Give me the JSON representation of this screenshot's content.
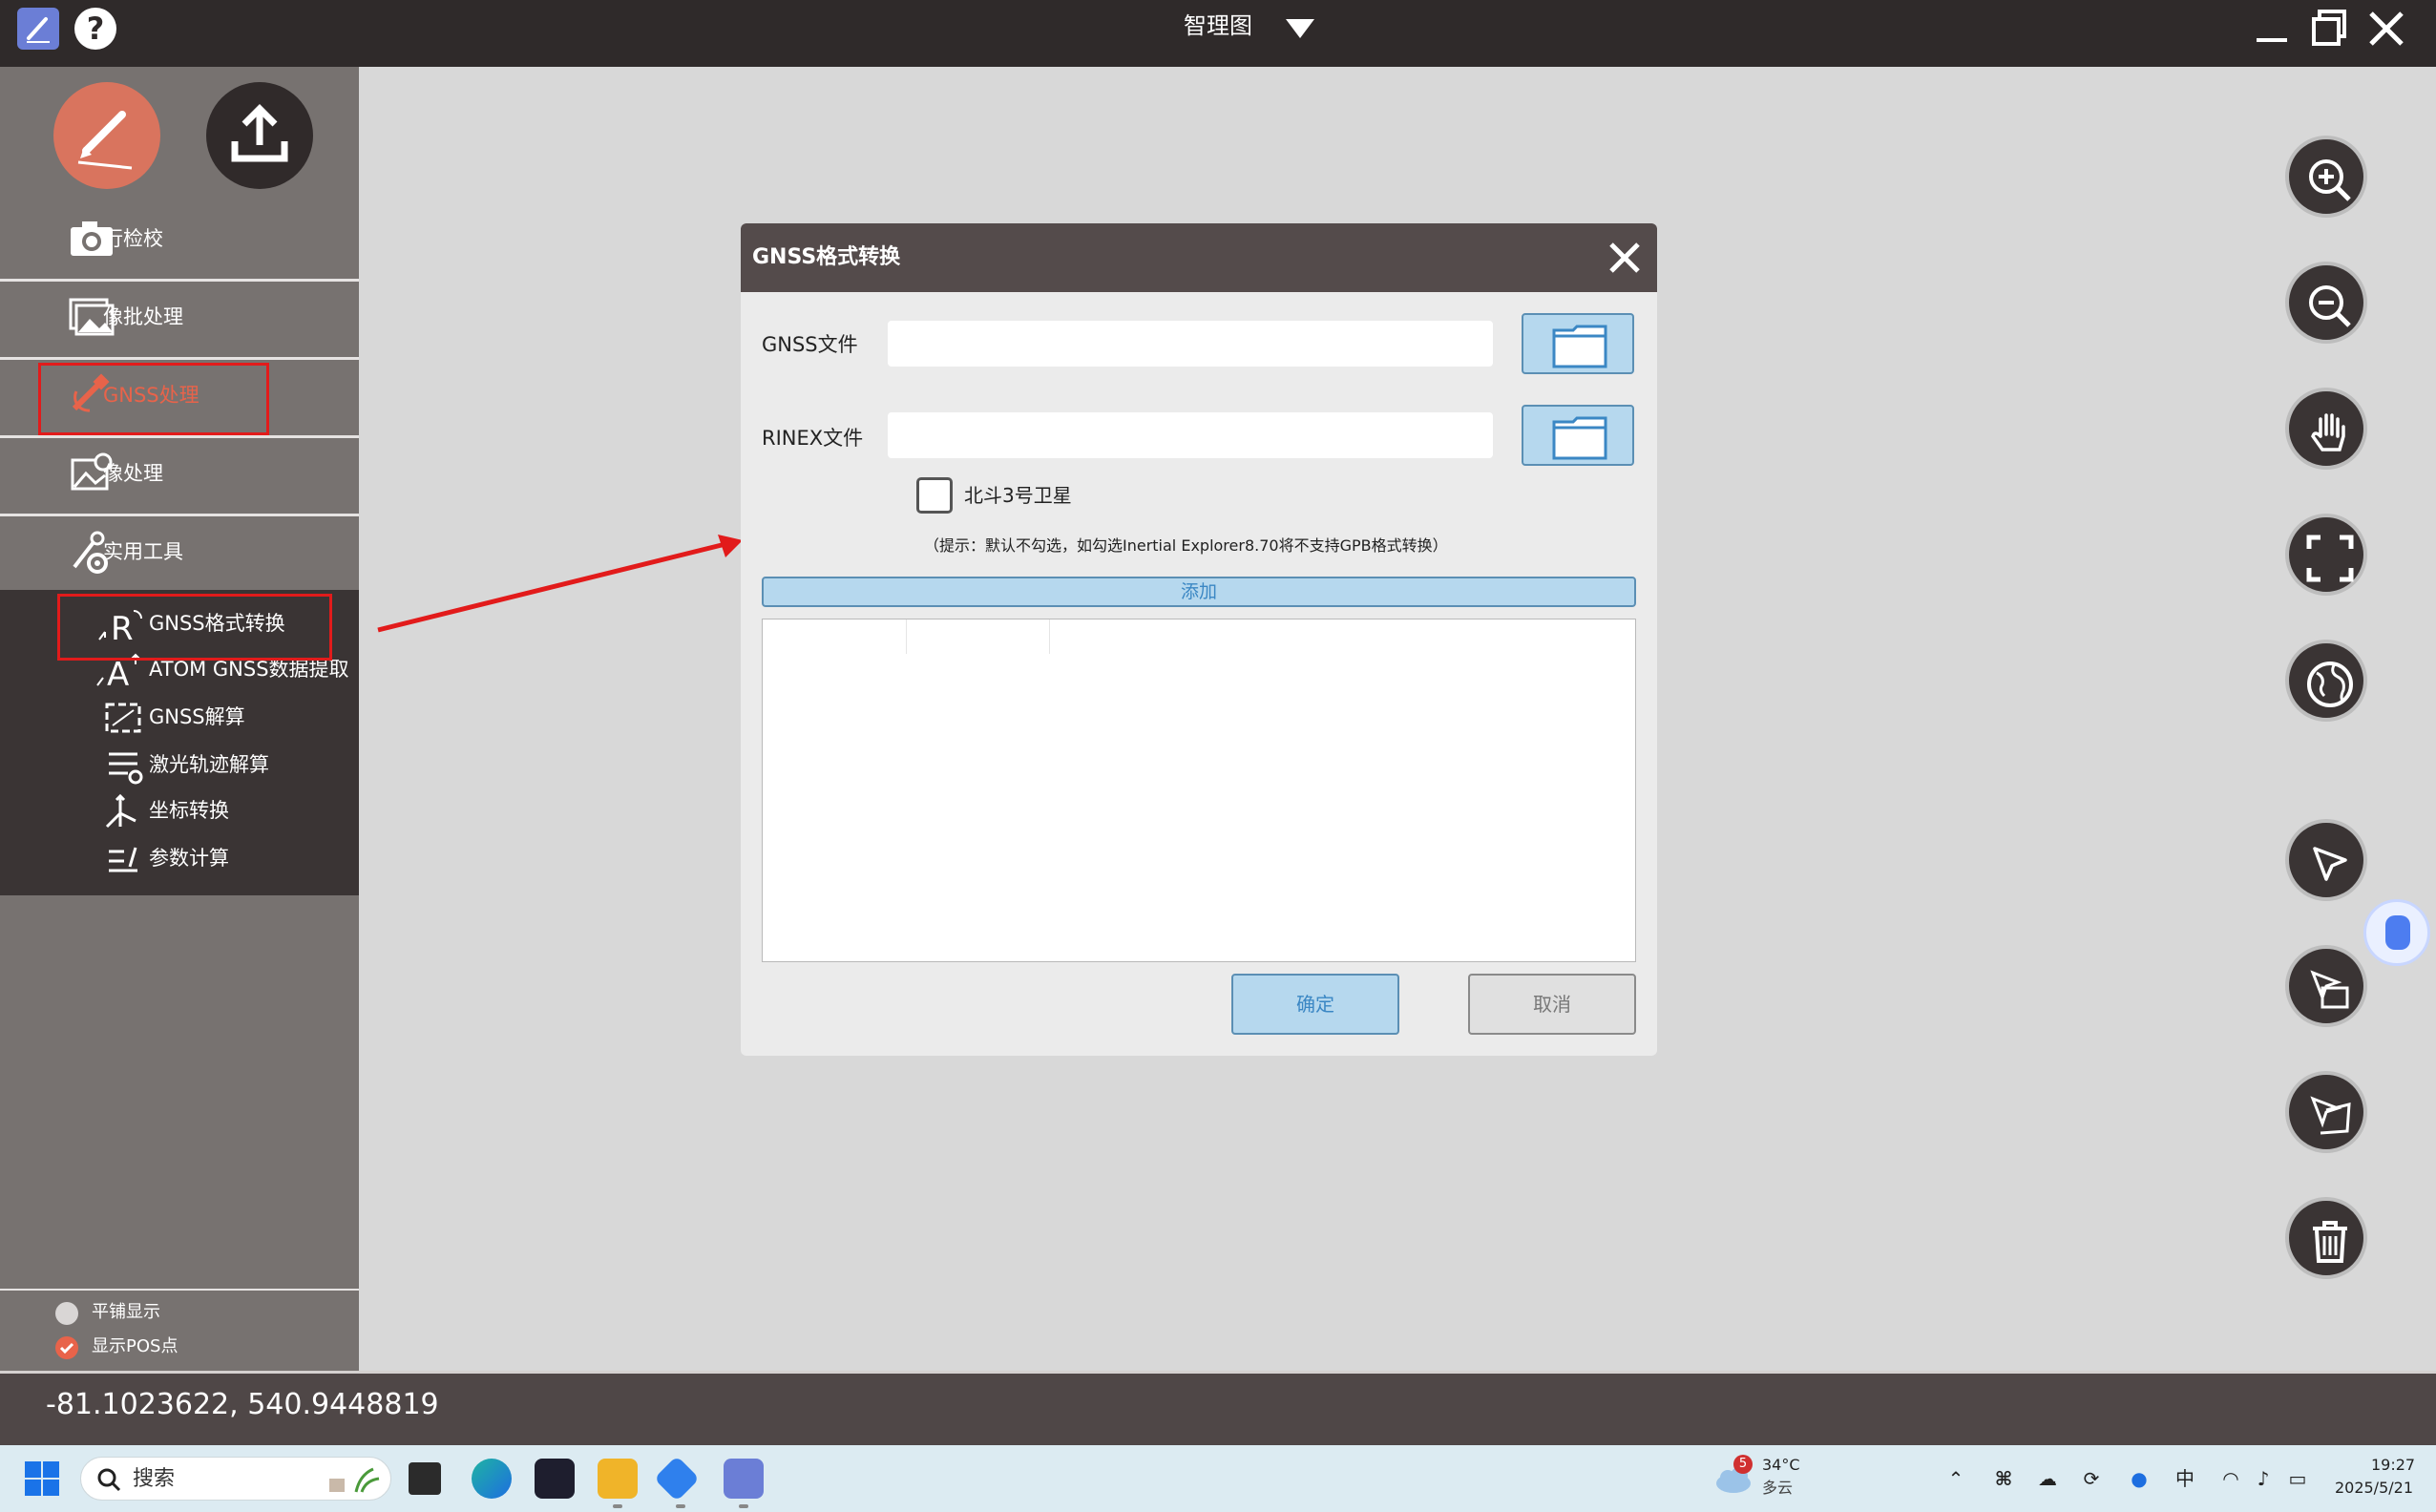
{
  "window": {
    "title": "智理图"
  },
  "sidebar": {
    "items": [
      {
        "label": "行检校",
        "icon": "camera-icon"
      },
      {
        "label": "像批处理",
        "icon": "image-batch-icon"
      },
      {
        "label": "GNSS处理",
        "icon": "satellite-icon",
        "selected": true
      },
      {
        "label": "像处理",
        "icon": "image-process-icon"
      },
      {
        "label": "实用工具",
        "icon": "tools-icon"
      }
    ],
    "subitems": [
      {
        "label": "GNSS格式转换",
        "icon": "rinex-convert-icon"
      },
      {
        "label": "ATOM GNSS数据提取",
        "icon": "atom-extract-icon"
      },
      {
        "label": "GNSS解算",
        "icon": "gnss-solve-icon"
      },
      {
        "label": "激光轨迹解算",
        "icon": "laser-trajectory-icon"
      },
      {
        "label": "坐标转换",
        "icon": "coordinate-icon"
      },
      {
        "label": "参数计算",
        "icon": "parameter-icon"
      }
    ],
    "options": [
      {
        "label": "平铺显示",
        "checked": false
      },
      {
        "label": "显示POS点",
        "checked": true
      }
    ]
  },
  "status": {
    "coordinates": "-81.1023622, 540.9448819"
  },
  "dialog": {
    "title": "GNSS格式转换",
    "gnss_file_label": "GNSS文件",
    "gnss_file_value": "",
    "rinex_file_label": "RINEX文件",
    "rinex_file_value": "",
    "beidou_label": "北斗3号卫星",
    "beidou_checked": false,
    "hint": "（提示：默认不勾选，如勾选Inertial Explorer8.70将不支持GPB格式转换）",
    "add_label": "添加",
    "ok_label": "确定",
    "cancel_label": "取消"
  },
  "taskbar": {
    "search_label": "搜索",
    "weather_badge": "5",
    "weather_temp": "34°C",
    "weather_desc": "多云",
    "ime": "中",
    "time": "19:27",
    "date": "2025/5/21"
  },
  "colors": {
    "titlebar": "#2f2a2a",
    "sidebar": "#777270",
    "submenu": "#3a3434",
    "accent_red": "#e8634a",
    "dialog_button": "#b6d8ee",
    "highlight_box": "#e21b1b"
  }
}
